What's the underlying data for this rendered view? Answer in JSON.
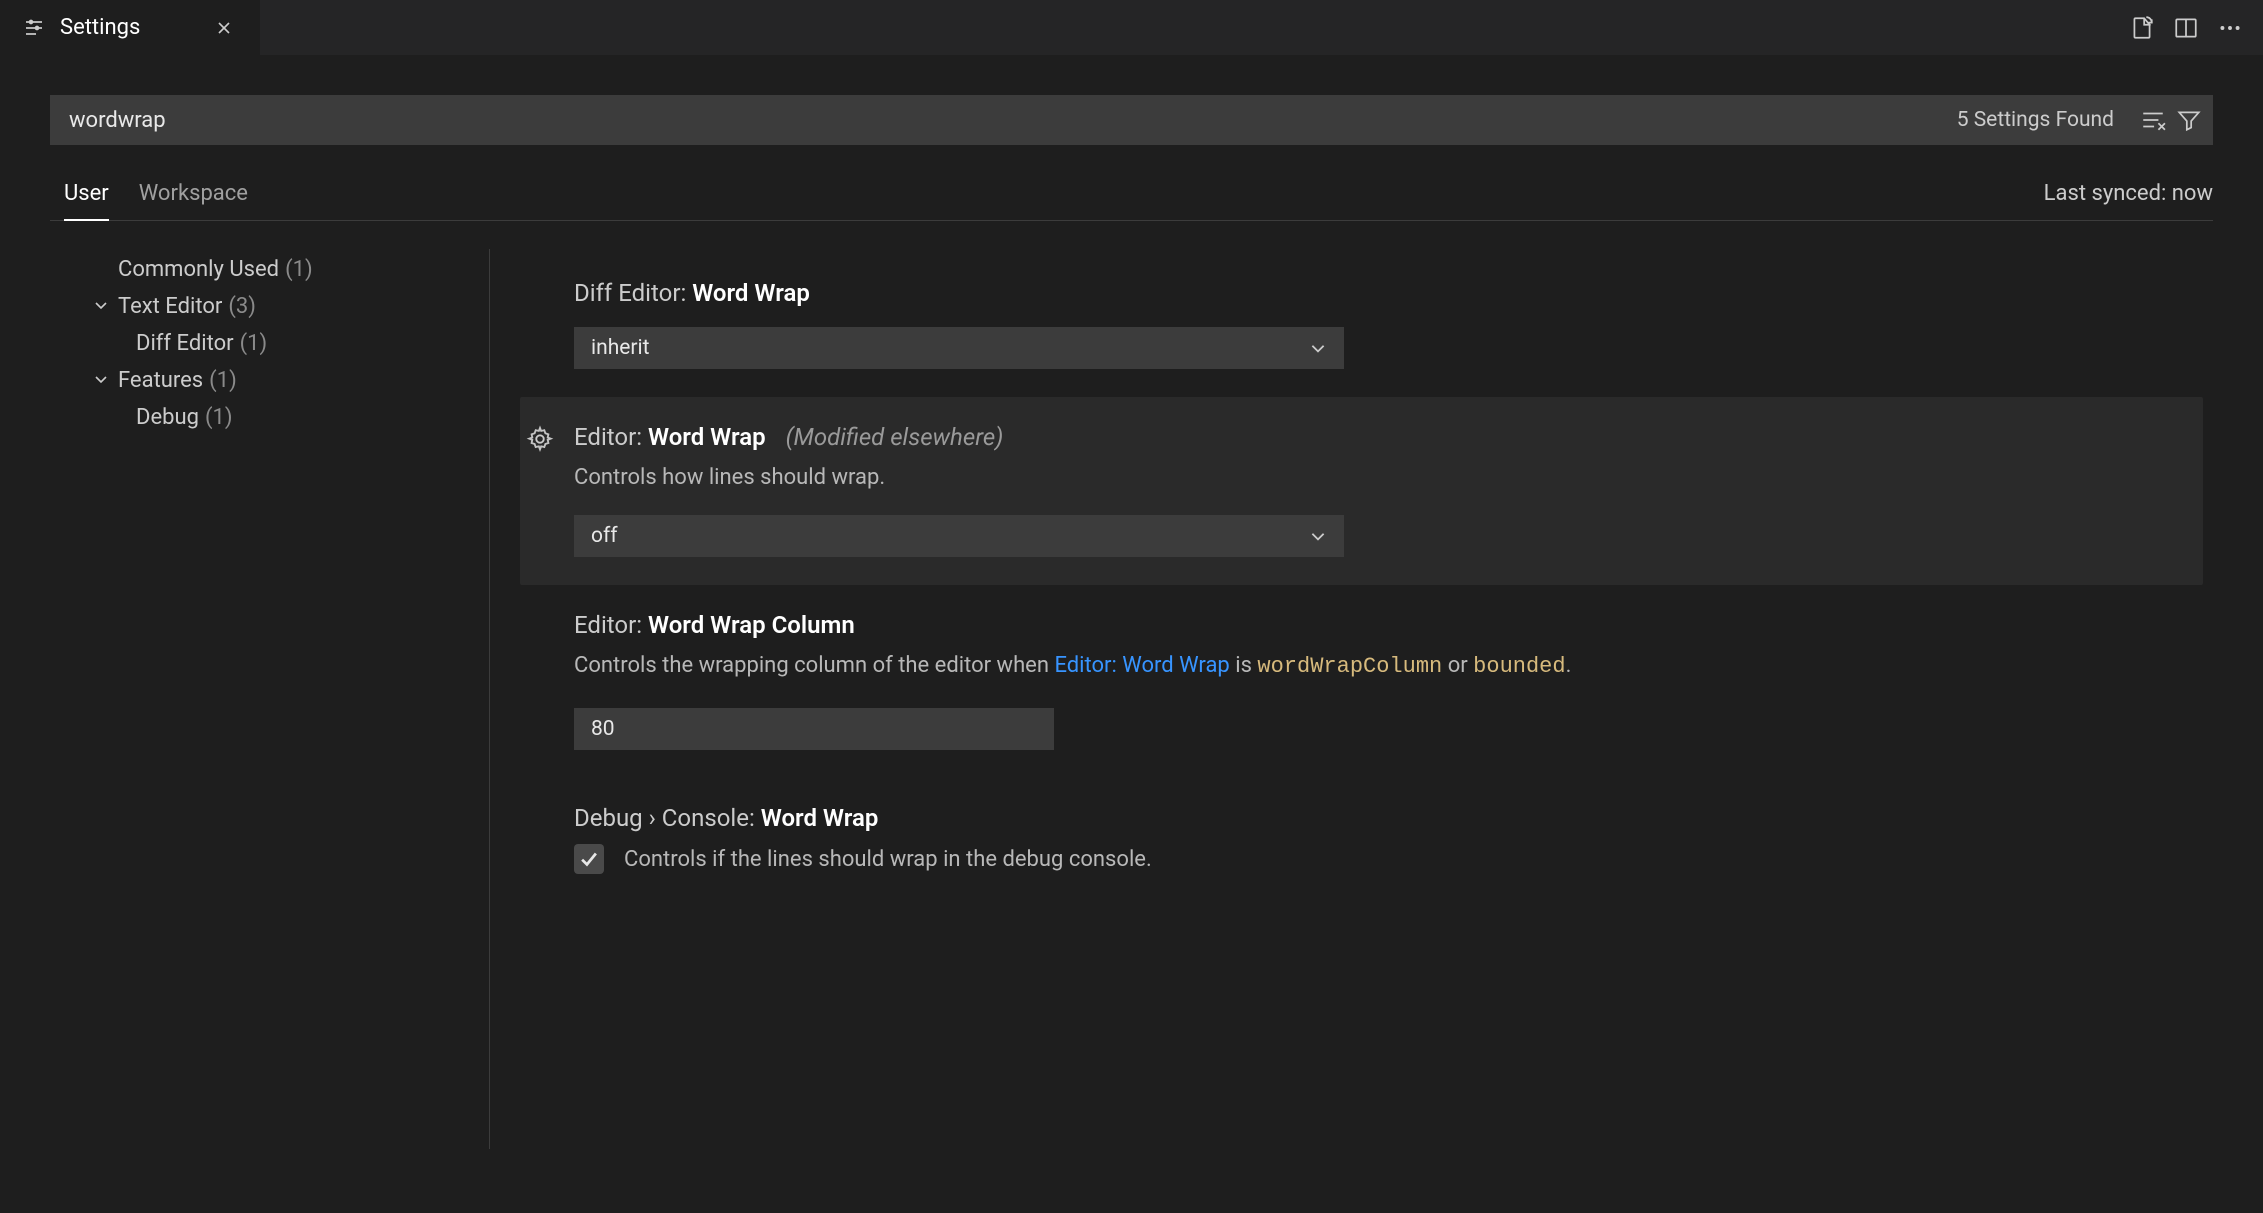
{
  "tab": {
    "title": "Settings"
  },
  "search": {
    "value": "wordwrap",
    "found_text": "5 Settings Found"
  },
  "scope": {
    "user": "User",
    "workspace": "Workspace",
    "sync_status": "Last synced: now"
  },
  "tree": {
    "commonly_used": {
      "label": "Commonly Used",
      "count": "(1)"
    },
    "text_editor": {
      "label": "Text Editor",
      "count": "(3)"
    },
    "diff_editor": {
      "label": "Diff Editor",
      "count": "(1)"
    },
    "features": {
      "label": "Features",
      "count": "(1)"
    },
    "debug": {
      "label": "Debug",
      "count": "(1)"
    }
  },
  "settings": {
    "diff_wordwrap": {
      "scope": "Diff Editor: ",
      "name": "Word Wrap",
      "value": "inherit"
    },
    "editor_wordwrap": {
      "scope": "Editor: ",
      "name": "Word Wrap",
      "modnote": "(Modified elsewhere)",
      "desc": "Controls how lines should wrap.",
      "value": "off"
    },
    "editor_wordwrap_column": {
      "scope": "Editor: ",
      "name": "Word Wrap Column",
      "desc_prefix": "Controls the wrapping column of the editor when ",
      "link_text": "Editor: Word Wrap",
      "desc_mid": " is ",
      "code1": "wordWrapColumn",
      "desc_or": " or ",
      "code2": "bounded",
      "desc_suffix": ".",
      "value": "80"
    },
    "debug_console_wordwrap": {
      "scope": "Debug › Console: ",
      "name": "Word Wrap",
      "check_label": "Controls if the lines should wrap in the debug console."
    }
  }
}
